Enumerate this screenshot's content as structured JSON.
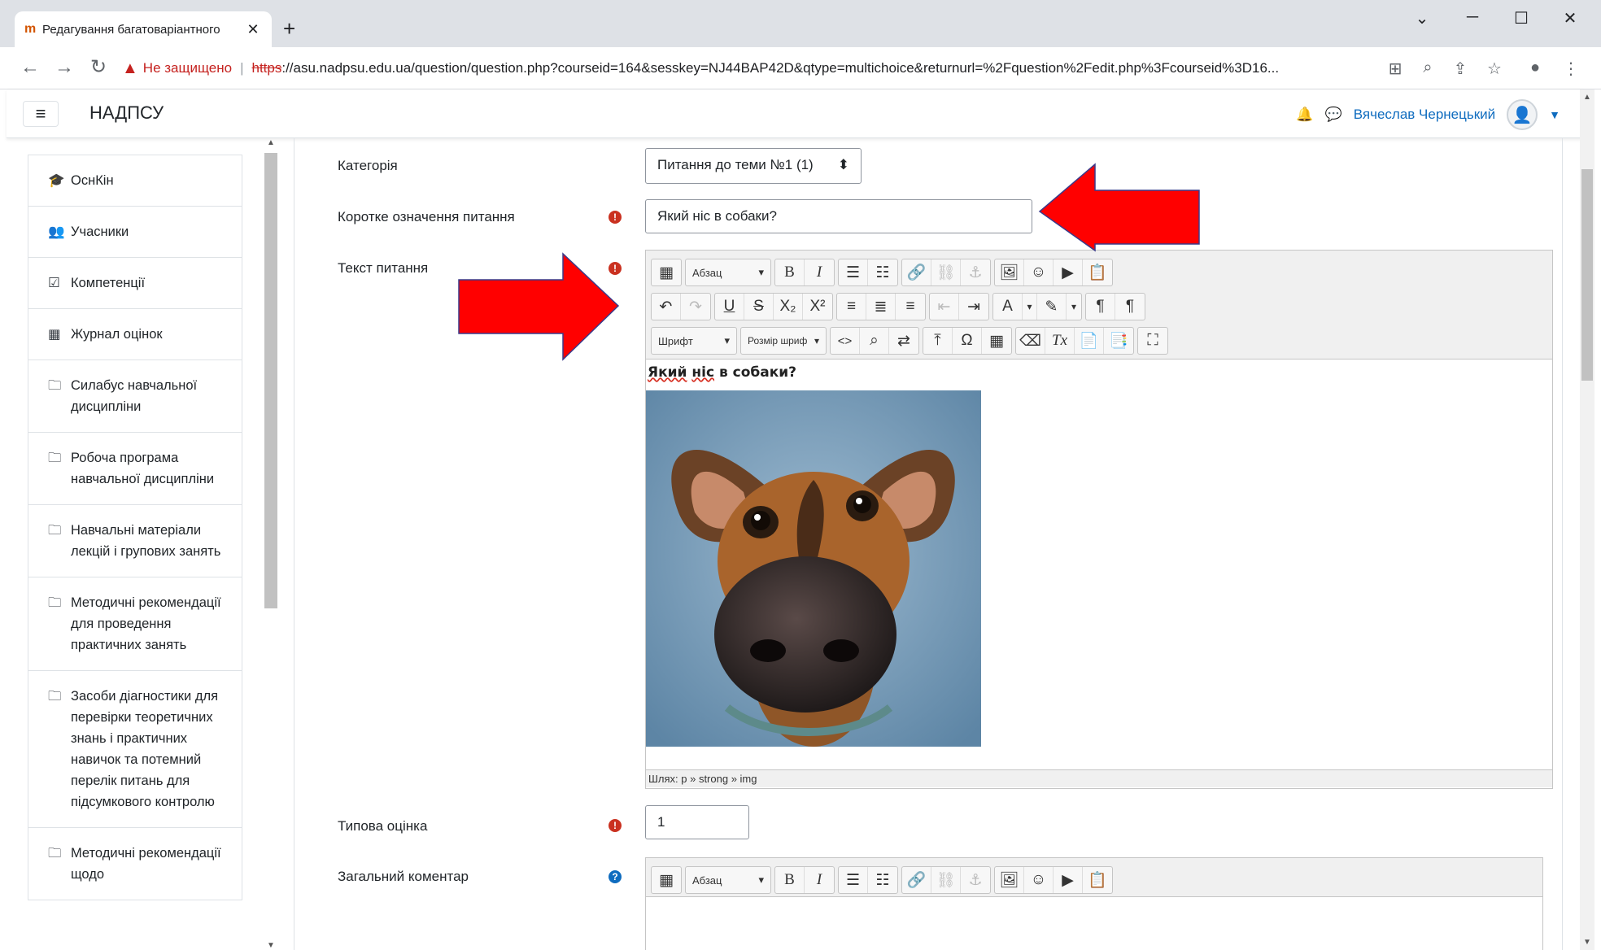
{
  "browser": {
    "tab_title": "Редагування багатоваріантного",
    "tab_close": "✕",
    "new_tab": "+",
    "security_warning": "Не защищено",
    "url_scheme": "https",
    "url_rest": "://asu.nadpsu.edu.ua/question/question.php?courseid=164&sesskey=NJ44BAP42D&qtype=multichoice&returnurl=%2Fquestion%2Fedit.php%3Fcourseid%3D16..."
  },
  "navbar": {
    "brand": "НАДПСУ",
    "username": "Вячеслав Чернецький"
  },
  "sidebar": {
    "items": [
      {
        "icon": "graduation-cap-icon",
        "glyph": "🎓",
        "label": "ОснКін"
      },
      {
        "icon": "users-icon",
        "glyph": "👥",
        "label": "Учасники"
      },
      {
        "icon": "checkbox-icon",
        "glyph": "☑",
        "label": "Компетенції"
      },
      {
        "icon": "table-icon",
        "glyph": "▦",
        "label": "Журнал оцінок"
      },
      {
        "icon": "folder-icon",
        "glyph": "🗀",
        "label": "Силабус навчальної дисципліни"
      },
      {
        "icon": "folder-icon",
        "glyph": "🗀",
        "label": "Робоча програма навчальної дисципліни"
      },
      {
        "icon": "folder-icon",
        "glyph": "🗀",
        "label": "Навчальні матеріали лекцій і групових занять"
      },
      {
        "icon": "folder-icon",
        "glyph": "🗀",
        "label": "Методичні рекомендації для проведення практичних занять"
      },
      {
        "icon": "folder-icon",
        "glyph": "🗀",
        "label": "Засоби діагностики для перевірки теоретичних знань і практичних навичок та потемний перелік питань для підсумкового контролю"
      },
      {
        "icon": "folder-icon",
        "glyph": "🗀",
        "label": "Методичні рекомендації щодо"
      }
    ]
  },
  "form": {
    "category_label": "Категорія",
    "category_value": "Питання до теми №1 (1)",
    "short_label": "Коротке означення питання",
    "short_value": "Який ніс в собаки?",
    "text_label": "Текст питання",
    "para_select": "Абзац",
    "font_select": "Шрифт",
    "size_select": "Розмір шриф",
    "question_word1": "Який",
    "question_word2": "ніс",
    "question_rest": " в собаки?",
    "status_path": "Шлях: p » strong » img",
    "grade_label": "Типова оцінка",
    "grade_value": "1",
    "feedback_label": "Загальний коментар",
    "para_select2": "Абзац"
  },
  "colors": {
    "accent": "#0f6cbf",
    "required": "#ca3120",
    "arrow": "#ff0000"
  }
}
